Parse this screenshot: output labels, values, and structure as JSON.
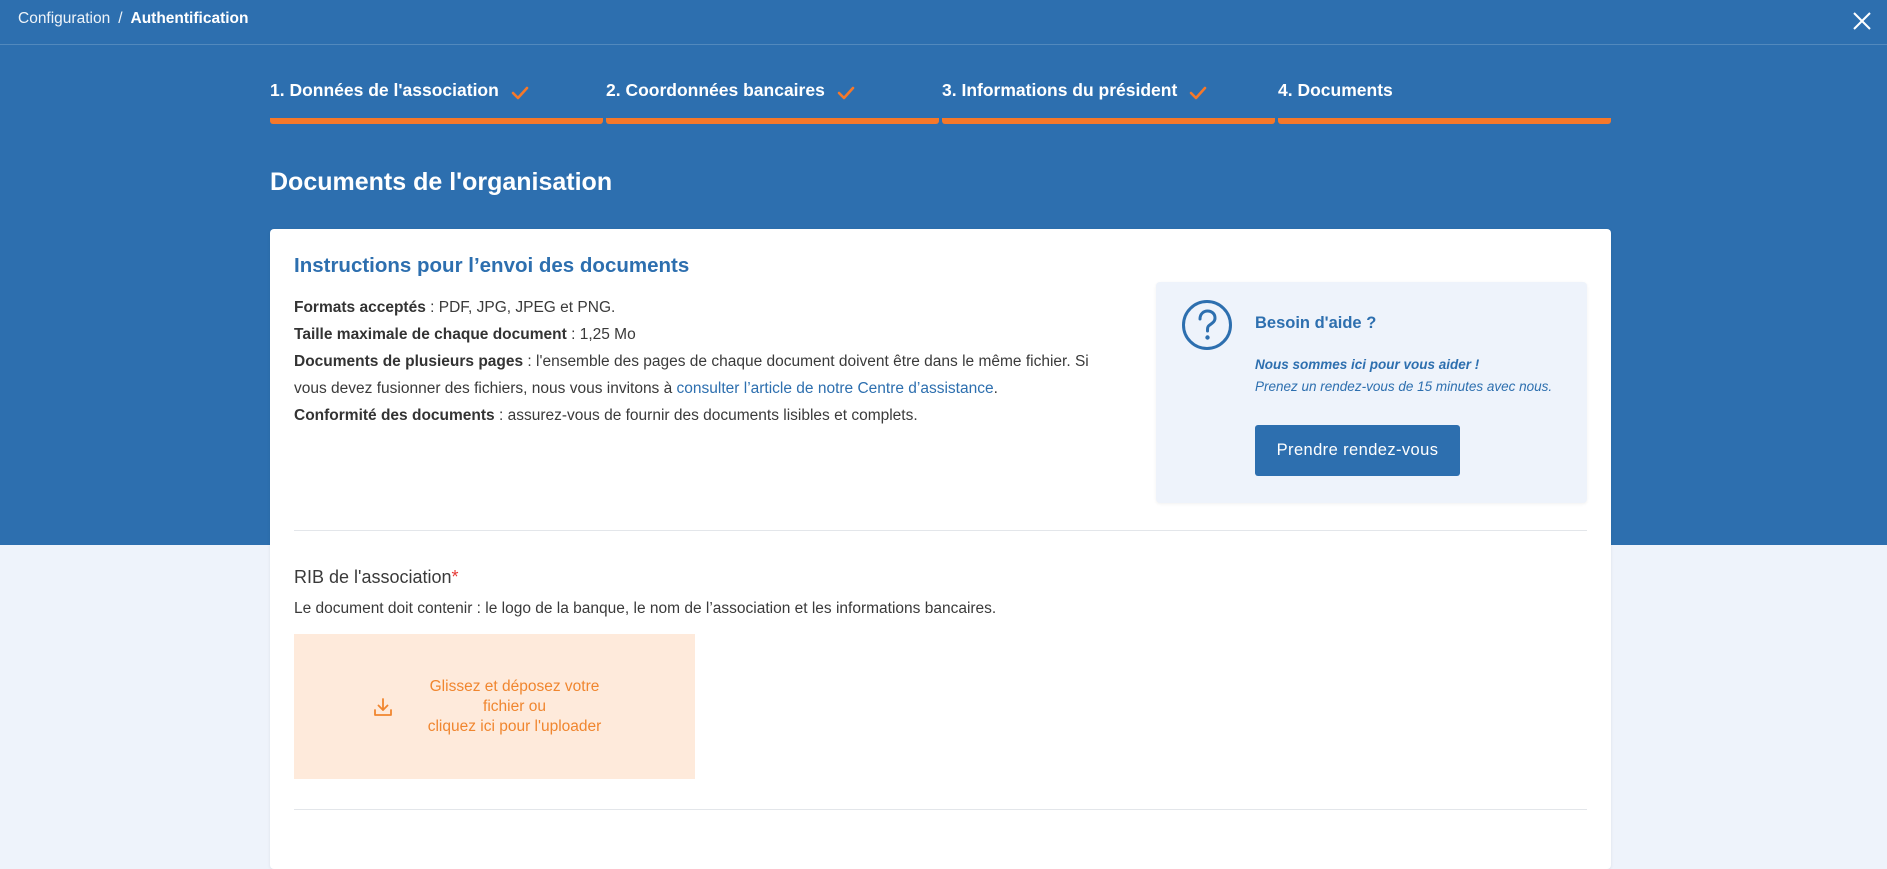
{
  "breadcrumb": {
    "parent": "Configuration",
    "separator": "/",
    "current": "Authentification"
  },
  "close_icon": "close-icon",
  "steps": [
    {
      "label": "1. Données de l'association",
      "completed": true
    },
    {
      "label": "2. Coordonnées bancaires",
      "completed": true
    },
    {
      "label": "3. Informations du président",
      "completed": true
    },
    {
      "label": "4. Documents",
      "completed": false
    }
  ],
  "page": {
    "title": "Documents de l'organisation"
  },
  "instructions": {
    "title": "Instructions pour l’envoi des documents",
    "formats_label": "Formats acceptés",
    "formats_value": " : PDF, JPG, JPEG et PNG.",
    "size_label": "Taille maximale de chaque document",
    "size_value": " : 1,25 Mo",
    "multipage_label": "Documents de plusieurs pages",
    "multipage_value": " : l'ensemble des pages de chaque document doivent être dans le même fichier. Si vous devez fusionner des fichiers, nous vous invitons à ",
    "multipage_link": "consulter l’article de notre Centre d’assistance",
    "multipage_end": ".",
    "conformity_label": "Conformité des documents",
    "conformity_value": " : assurez-vous de fournir des documents lisibles et complets."
  },
  "help": {
    "icon": "question-circle-icon",
    "title": "Besoin d'aide ?",
    "line1": "Nous sommes ici pour vous aider !",
    "line2": "Prenez un rendez-vous de 15 minutes avec nous.",
    "button_label": "Prendre rendez-vous"
  },
  "rib": {
    "label": "RIB de l'association",
    "required_mark": "*",
    "description": "Le document doit contenir : le logo de la banque, le nom de l’association et les informations bancaires.",
    "dropzone_icon": "download-icon",
    "dropzone_line1": "Glissez et déposez votre fichier ou",
    "dropzone_line2": "cliquez ici pour l'uploader"
  },
  "colors": {
    "brand_blue": "#2d6faf",
    "accent_orange": "#f5782a",
    "dropzone_bg": "#feeadb",
    "page_bg": "#eef3fb"
  }
}
